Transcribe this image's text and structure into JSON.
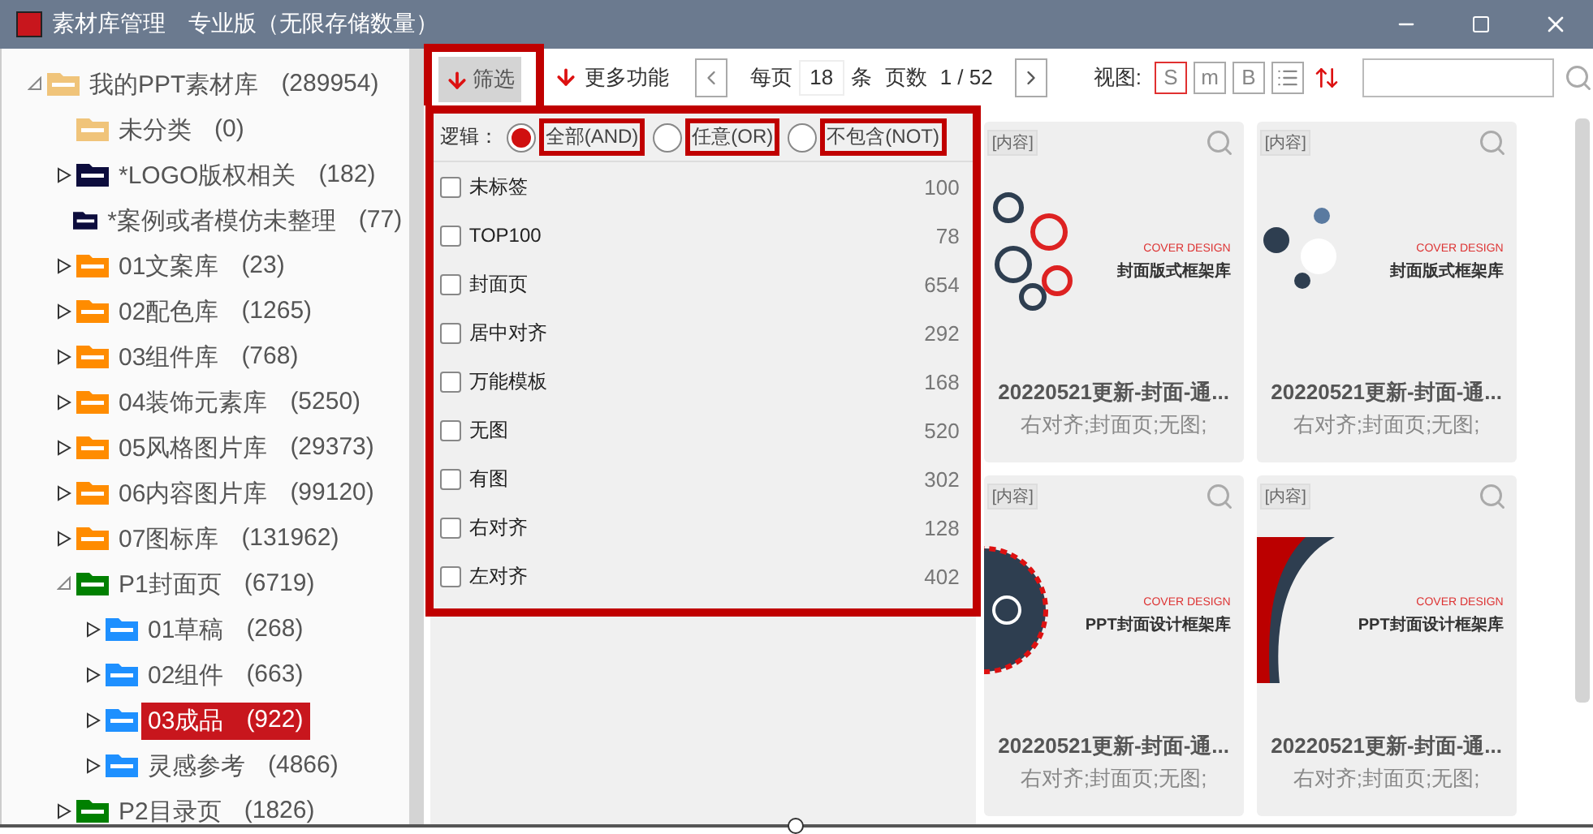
{
  "window": {
    "title": "素材库管理",
    "edition": "专业版（无限存储数量）"
  },
  "tree": [
    {
      "label": "我的PPT素材库",
      "count": "(289954)",
      "color": "#f0c47a",
      "kind": "branch",
      "expanded": true,
      "selected": false,
      "children": [
        {
          "label": "未分类",
          "count": "(0)",
          "color": "#f0c47a",
          "kind": "leaf",
          "selected": false
        },
        {
          "label": "*LOGO版权相关",
          "count": "(182)",
          "color": "#0d0d3d",
          "kind": "branch",
          "expanded": false,
          "selected": false
        },
        {
          "label": "*案例或者模仿未整理",
          "count": "(77)",
          "color": "#0d0d3d",
          "kind": "leaf",
          "selected": false
        },
        {
          "label": "01文案库",
          "count": "(23)",
          "color": "#ff8c00",
          "kind": "branch",
          "expanded": false,
          "selected": false
        },
        {
          "label": "02配色库",
          "count": "(1265)",
          "color": "#ff8c00",
          "kind": "branch",
          "expanded": false,
          "selected": false
        },
        {
          "label": "03组件库",
          "count": "(768)",
          "color": "#ff8c00",
          "kind": "branch",
          "expanded": false,
          "selected": false
        },
        {
          "label": "04装饰元素库",
          "count": "(5250)",
          "color": "#ff8c00",
          "kind": "branch",
          "expanded": false,
          "selected": false
        },
        {
          "label": "05风格图片库",
          "count": "(29373)",
          "color": "#ff8c00",
          "kind": "branch",
          "expanded": false,
          "selected": false
        },
        {
          "label": "06内容图片库",
          "count": "(99120)",
          "color": "#ff8c00",
          "kind": "branch",
          "expanded": false,
          "selected": false
        },
        {
          "label": "07图标库",
          "count": "(131962)",
          "color": "#ff8c00",
          "kind": "branch",
          "expanded": false,
          "selected": false
        },
        {
          "label": "P1封面页",
          "count": "(6719)",
          "color": "#008000",
          "kind": "branch",
          "expanded": true,
          "selected": false,
          "children": [
            {
              "label": "01草稿",
              "count": "(268)",
              "color": "#1e90ff",
              "kind": "branch",
              "expanded": false,
              "selected": false
            },
            {
              "label": "02组件",
              "count": "(663)",
              "color": "#1e90ff",
              "kind": "branch",
              "expanded": false,
              "selected": false
            },
            {
              "label": "03成品",
              "count": "(922)",
              "color": "#1e90ff",
              "kind": "branch",
              "expanded": false,
              "selected": true
            },
            {
              "label": "灵感参考",
              "count": "(4866)",
              "color": "#1e90ff",
              "kind": "branch",
              "expanded": false,
              "selected": false
            }
          ]
        },
        {
          "label": "P2目录页",
          "count": "(1826)",
          "color": "#008000",
          "kind": "branch",
          "expanded": false,
          "selected": false
        }
      ]
    }
  ],
  "toolbar": {
    "filter_button": "筛选",
    "more_button": "更多功能",
    "per_page_label": "每页",
    "per_page_value": "18",
    "unit_label": "条",
    "pages_label": "页数",
    "pages": "1 / 52",
    "view_label": "视图:",
    "view_modes": [
      {
        "label": "S",
        "selected": true
      },
      {
        "label": "m",
        "selected": false
      },
      {
        "label": "B",
        "selected": false
      }
    ]
  },
  "filter": {
    "logic_label": "逻辑：",
    "logic_options": [
      {
        "label": "全部(AND)",
        "selected": true
      },
      {
        "label": "任意(OR)",
        "selected": false
      },
      {
        "label": "不包含(NOT)",
        "selected": false
      }
    ],
    "tags": [
      {
        "label": "未标签",
        "count": "100",
        "checked": false
      },
      {
        "label": "TOP100",
        "count": "78",
        "checked": false
      },
      {
        "label": "封面页",
        "count": "654",
        "checked": false
      },
      {
        "label": "居中对齐",
        "count": "292",
        "checked": false
      },
      {
        "label": "万能模板",
        "count": "168",
        "checked": false
      },
      {
        "label": "无图",
        "count": "520",
        "checked": false
      },
      {
        "label": "有图",
        "count": "302",
        "checked": false
      },
      {
        "label": "右对齐",
        "count": "128",
        "checked": false
      },
      {
        "label": "左对齐",
        "count": "402",
        "checked": false
      }
    ]
  },
  "cards": [
    {
      "badge": "[内容]",
      "kind": "network",
      "cover_label": "COVER DESIGN",
      "cover_title": "封面版式框架库",
      "title": "20220521更新-封面-通...",
      "tags": "右对齐;封面页;无图;"
    },
    {
      "badge": "[内容]",
      "kind": "bubbles",
      "cover_label": "COVER DESIGN",
      "cover_title": "封面版式框架库",
      "title": "20220521更新-封面-通...",
      "tags": "右对齐;封面页;无图;"
    },
    {
      "badge": "[内容]",
      "kind": "seal",
      "cover_label": "COVER DESIGN",
      "cover_title": "PPT封面设计框架库",
      "title": "20220521更新-封面-通...",
      "tags": "右对齐;封面页;无图;"
    },
    {
      "badge": "[内容]",
      "kind": "swoosh",
      "cover_label": "COVER DESIGN",
      "cover_title": "PPT封面设计框架库",
      "title": "20220521更新-封面-通...",
      "tags": "右对齐;封面页;无图;"
    }
  ]
}
